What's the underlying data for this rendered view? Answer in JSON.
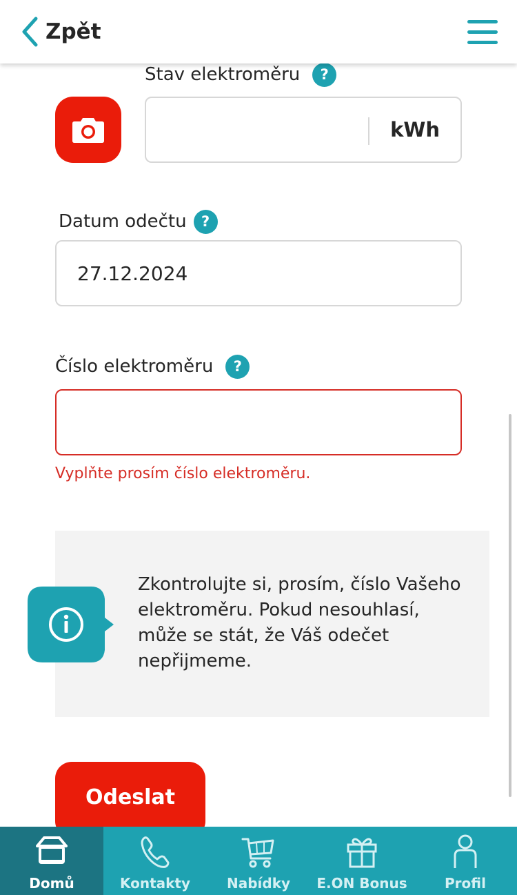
{
  "header": {
    "back_label": "Zpět"
  },
  "form": {
    "meter_state": {
      "label": "Stav elektroměru",
      "unit": "kWh",
      "value": ""
    },
    "read_date": {
      "label": "Datum odečtu",
      "value": "27.12.2024"
    },
    "meter_number": {
      "label": "Číslo elektroměru",
      "value": "",
      "error": "Vyplňte prosím číslo elektroměru."
    }
  },
  "info": {
    "text": "Zkontrolujte si, prosím, číslo Vašeho elektroměru. Pokud nesouhlasí, může se stát, že Váš odečet nepřijmeme."
  },
  "submit_label": "Odeslat",
  "bottom_nav": [
    {
      "label": "Domů",
      "icon": "home-icon",
      "active": true
    },
    {
      "label": "Kontakty",
      "icon": "phone-icon",
      "active": false
    },
    {
      "label": "Nabídky",
      "icon": "cart-icon",
      "active": false
    },
    {
      "label": "E.ON Bonus",
      "icon": "gift-icon",
      "active": false
    },
    {
      "label": "Profil",
      "icon": "profile-icon",
      "active": false
    }
  ],
  "colors": {
    "accent": "#1ea2b1",
    "active_nav": "#1c7482",
    "primary": "#ea1c0a",
    "error": "#d62d26",
    "info_bg": "#f3f3f3"
  }
}
